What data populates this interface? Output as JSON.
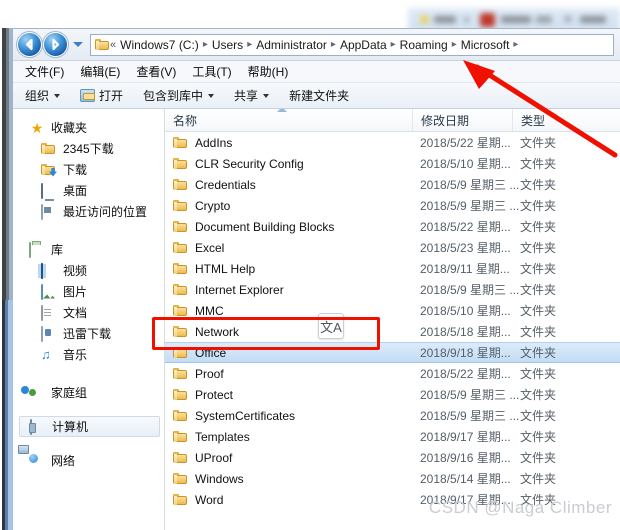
{
  "window": {
    "address_path": [
      "Windows7 (C:)",
      "Users",
      "Administrator",
      "AppData",
      "Roaming",
      "Microsoft"
    ],
    "address_chevron": "«",
    "separator": "▸"
  },
  "menubar": {
    "items": [
      {
        "label": "文件(F)",
        "name": "menu-file"
      },
      {
        "label": "编辑(E)",
        "name": "menu-edit"
      },
      {
        "label": "查看(V)",
        "name": "menu-view"
      },
      {
        "label": "工具(T)",
        "name": "menu-tools"
      },
      {
        "label": "帮助(H)",
        "name": "menu-help"
      }
    ]
  },
  "toolbar": {
    "organize": "组织",
    "open": "打开",
    "include_in_library": "包含到库中",
    "share": "共享",
    "new_folder": "新建文件夹"
  },
  "sidebar": {
    "favorites": {
      "label": "收藏夹",
      "items": [
        {
          "label": "2345下载",
          "icon": "folder-icon"
        },
        {
          "label": "下载",
          "icon": "downloads-icon"
        },
        {
          "label": "桌面",
          "icon": "desktop-icon"
        },
        {
          "label": "最近访问的位置",
          "icon": "recent-places-icon"
        }
      ]
    },
    "libraries": {
      "label": "库",
      "items": [
        {
          "label": "视频",
          "icon": "video-icon"
        },
        {
          "label": "图片",
          "icon": "pictures-icon"
        },
        {
          "label": "文档",
          "icon": "documents-icon"
        },
        {
          "label": "迅雷下载",
          "icon": "xunlei-icon"
        },
        {
          "label": "音乐",
          "icon": "music-icon"
        }
      ]
    },
    "homegroup": {
      "label": "家庭组",
      "icon": "homegroup-icon"
    },
    "computer": {
      "label": "计算机",
      "icon": "computer-icon",
      "selected": true
    },
    "network": {
      "label": "网络",
      "icon": "network-icon"
    }
  },
  "filelist": {
    "columns": {
      "name": "名称",
      "date_modified": "修改日期",
      "type": "类型"
    },
    "rows": [
      {
        "name": "AddIns",
        "date": "2018/5/22 星期...",
        "type": "文件夹"
      },
      {
        "name": "CLR Security Config",
        "date": "2018/5/10 星期...",
        "type": "文件夹"
      },
      {
        "name": "Credentials",
        "date": "2018/5/9 星期三 ...",
        "type": "文件夹"
      },
      {
        "name": "Crypto",
        "date": "2018/5/9 星期三 ...",
        "type": "文件夹"
      },
      {
        "name": "Document Building Blocks",
        "date": "2018/5/22 星期...",
        "type": "文件夹"
      },
      {
        "name": "Excel",
        "date": "2018/5/23 星期...",
        "type": "文件夹"
      },
      {
        "name": "HTML Help",
        "date": "2018/9/11 星期...",
        "type": "文件夹"
      },
      {
        "name": "Internet Explorer",
        "date": "2018/5/9 星期三 ...",
        "type": "文件夹"
      },
      {
        "name": "MMC",
        "date": "2018/5/10 星期...",
        "type": "文件夹"
      },
      {
        "name": "Network",
        "date": "2018/5/18 星期...",
        "type": "文件夹"
      },
      {
        "name": "Office",
        "date": "2018/9/18 星期...",
        "type": "文件夹",
        "selected": true
      },
      {
        "name": "Proof",
        "date": "2018/5/22 星期...",
        "type": "文件夹"
      },
      {
        "name": "Protect",
        "date": "2018/5/9 星期三 ...",
        "type": "文件夹"
      },
      {
        "name": "SystemCertificates",
        "date": "2018/5/9 星期三 ...",
        "type": "文件夹"
      },
      {
        "name": "Templates",
        "date": "2018/9/17 星期...",
        "type": "文件夹"
      },
      {
        "name": "UProof",
        "date": "2018/9/16 星期...",
        "type": "文件夹"
      },
      {
        "name": "Windows",
        "date": "2018/5/14 星期...",
        "type": "文件夹"
      },
      {
        "name": "Word",
        "date": "2018/9/17 星期...",
        "type": "文件夹"
      }
    ]
  },
  "overlays": {
    "translate_glyph": "文A",
    "watermark": "CSDN @Naga Climber",
    "annotation_color": "#f01000"
  }
}
